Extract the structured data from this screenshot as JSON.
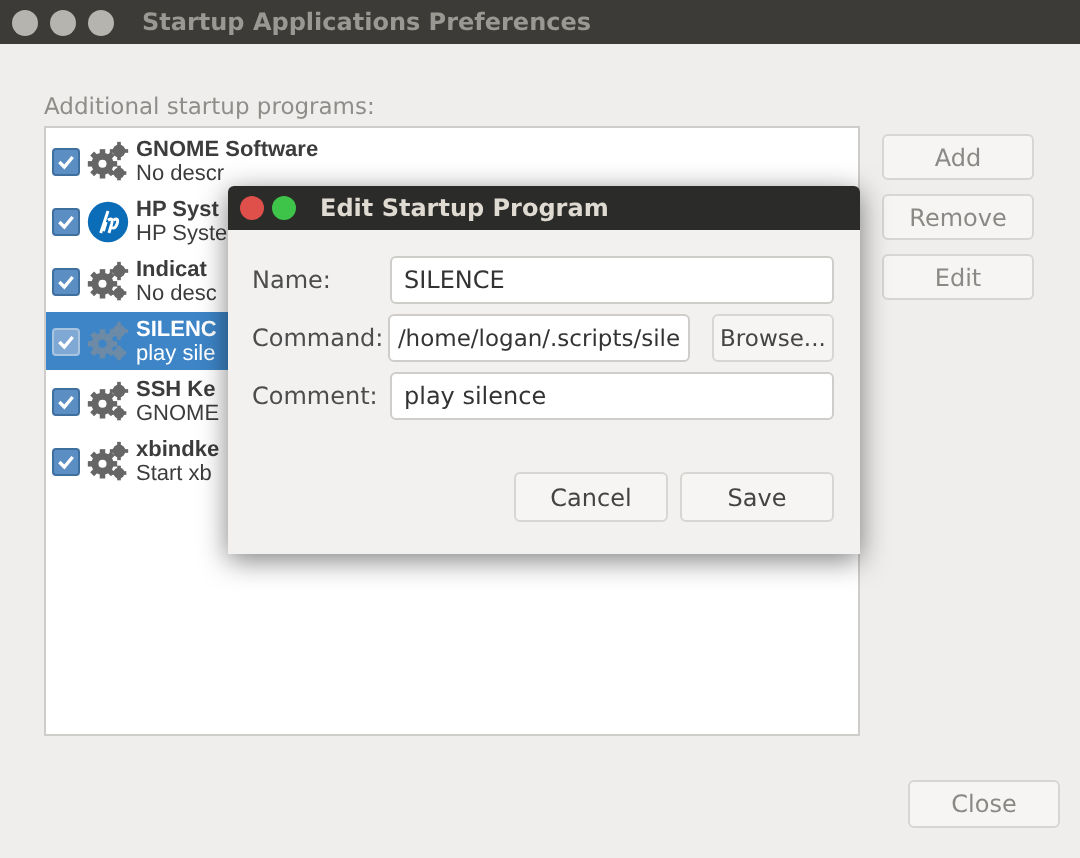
{
  "window": {
    "title": "Startup Applications Preferences"
  },
  "list_label": "Additional startup programs:",
  "programs": [
    {
      "name": "GNOME Software",
      "description": "No descr",
      "checked": true,
      "selected": false,
      "kind": "gear"
    },
    {
      "name": "HP Syst",
      "description": "HP Syste",
      "checked": true,
      "selected": false,
      "kind": "hp"
    },
    {
      "name": "Indicat",
      "description": "No desc",
      "checked": true,
      "selected": false,
      "kind": "gear"
    },
    {
      "name": "SILENC",
      "description": "play sile",
      "checked": true,
      "selected": true,
      "kind": "gear"
    },
    {
      "name": "SSH Ke",
      "description": "GNOME",
      "checked": true,
      "selected": false,
      "kind": "gear"
    },
    {
      "name": "xbindke",
      "description": "Start xb",
      "checked": true,
      "selected": false,
      "kind": "gear"
    }
  ],
  "side_buttons": [
    "Add",
    "Remove",
    "Edit"
  ],
  "close_button": "Close",
  "dialog": {
    "title": "Edit Startup Program",
    "name": {
      "label": "Name:",
      "value": "SILENCE"
    },
    "command": {
      "label": "Command:",
      "value": "/home/logan/.scripts/sile",
      "button": "Browse..."
    },
    "comment": {
      "label": "Comment:",
      "value": "play silence"
    },
    "buttons": [
      "Cancel",
      "Save"
    ]
  }
}
